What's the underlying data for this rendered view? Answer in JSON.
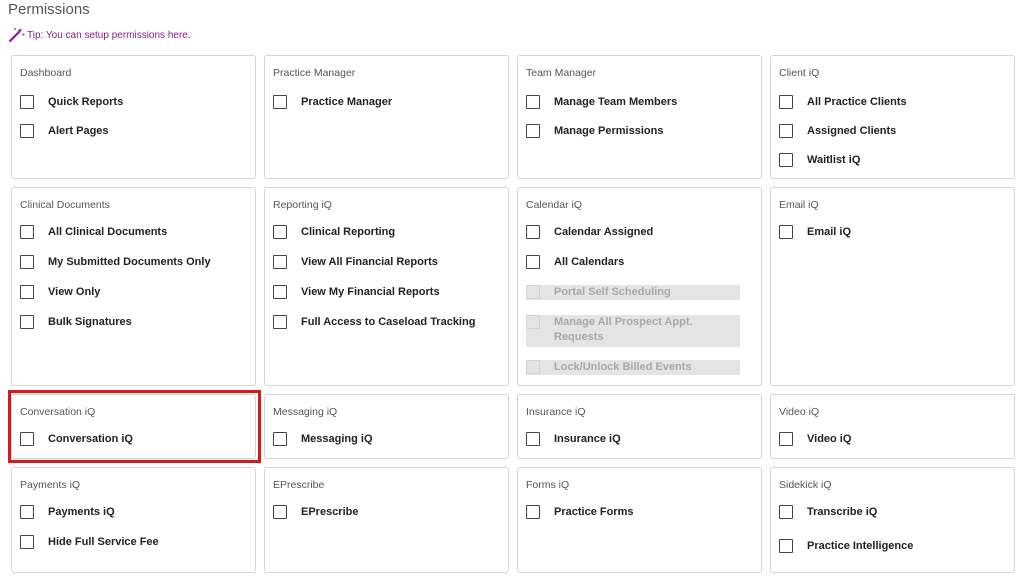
{
  "page": {
    "title": "Permissions",
    "tip": "Tip: You can setup permissions here."
  },
  "colors": {
    "tip": "#8b1a8b",
    "highlight": "#d41a1a",
    "border": "#d4d4d4"
  },
  "cards": {
    "dashboard": {
      "title": "Dashboard",
      "options": [
        "Quick Reports",
        "Alert Pages"
      ]
    },
    "practice_manager": {
      "title": "Practice Manager",
      "options": [
        "Practice Manager"
      ]
    },
    "team_manager": {
      "title": "Team Manager",
      "options": [
        "Manage Team Members",
        "Manage Permissions"
      ]
    },
    "client_iq": {
      "title": "Client iQ",
      "options": [
        "All Practice Clients",
        "Assigned Clients",
        "Waitlist iQ"
      ]
    },
    "clinical_documents": {
      "title": "Clinical Documents",
      "options": [
        "All Clinical Documents",
        "My Submitted Documents Only",
        "View Only",
        "Bulk Signatures"
      ]
    },
    "reporting_iq": {
      "title": "Reporting iQ",
      "options": [
        "Clinical Reporting",
        "View All Financial Reports",
        "View My Financial Reports",
        "Full Access to Caseload Tracking"
      ]
    },
    "calendar_iq": {
      "title": "Calendar iQ",
      "options": [
        "Calendar Assigned",
        "All Calendars",
        "Portal Self Scheduling",
        "Manage All Prospect Appt. Requests",
        "Lock/Unlock Billed Events"
      ]
    },
    "email_iq": {
      "title": "Email iQ",
      "options": [
        "Email iQ"
      ]
    },
    "conversation_iq": {
      "title": "Conversation iQ",
      "options": [
        "Conversation iQ"
      ]
    },
    "messaging_iq": {
      "title": "Messaging iQ",
      "options": [
        "Messaging iQ"
      ]
    },
    "insurance_iq": {
      "title": "Insurance iQ",
      "options": [
        "Insurance iQ"
      ]
    },
    "video_iq": {
      "title": "Video iQ",
      "options": [
        "Video iQ"
      ]
    },
    "payments_iq": {
      "title": "Payments iQ",
      "options": [
        "Payments iQ",
        "Hide Full Service Fee"
      ]
    },
    "eprescribe": {
      "title": "EPrescribe",
      "options": [
        "EPrescribe"
      ]
    },
    "forms_iq": {
      "title": "Forms iQ",
      "options": [
        "Practice Forms"
      ]
    },
    "sidekick_iq": {
      "title": "Sidekick iQ",
      "options": [
        "Transcribe iQ",
        "Practice Intelligence"
      ]
    }
  }
}
